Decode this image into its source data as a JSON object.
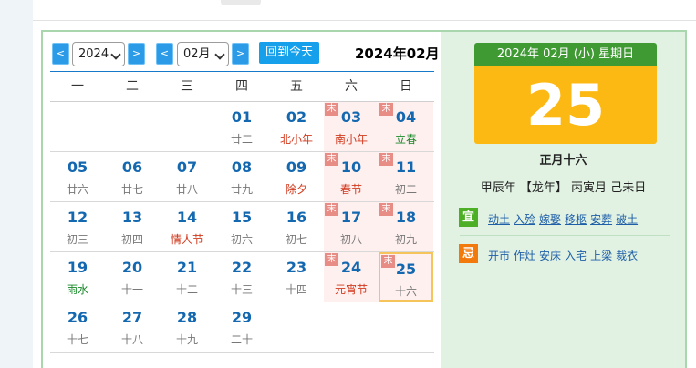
{
  "toolbar": {
    "prev_year": "<",
    "year": "2024",
    "next_year": ">",
    "prev_month": "<",
    "month": "02月",
    "next_month": ">",
    "today_label": "回到今天",
    "title": "2024年02月"
  },
  "weekdays": [
    "一",
    "二",
    "三",
    "四",
    "五",
    "六",
    "日"
  ],
  "badge_text": "末",
  "weeks": [
    [
      {
        "n": "",
        "l": ""
      },
      {
        "n": "",
        "l": ""
      },
      {
        "n": "",
        "l": ""
      },
      {
        "n": "01",
        "l": "廿二"
      },
      {
        "n": "02",
        "l": "北小年",
        "c": "red"
      },
      {
        "n": "03",
        "l": "南小年",
        "c": "red",
        "wk": true,
        "b": true
      },
      {
        "n": "04",
        "l": "立春",
        "c": "green",
        "wk": true,
        "b": true
      }
    ],
    [
      {
        "n": "05",
        "l": "廿六"
      },
      {
        "n": "06",
        "l": "廿七"
      },
      {
        "n": "07",
        "l": "廿八"
      },
      {
        "n": "08",
        "l": "廿九"
      },
      {
        "n": "09",
        "l": "除夕",
        "c": "red"
      },
      {
        "n": "10",
        "l": "春节",
        "c": "red",
        "wk": true,
        "b": true
      },
      {
        "n": "11",
        "l": "初二",
        "wk": true,
        "b": true
      }
    ],
    [
      {
        "n": "12",
        "l": "初三"
      },
      {
        "n": "13",
        "l": "初四"
      },
      {
        "n": "14",
        "l": "情人节",
        "c": "red"
      },
      {
        "n": "15",
        "l": "初六"
      },
      {
        "n": "16",
        "l": "初七"
      },
      {
        "n": "17",
        "l": "初八",
        "wk": true,
        "b": true
      },
      {
        "n": "18",
        "l": "初九",
        "wk": true,
        "b": true
      }
    ],
    [
      {
        "n": "19",
        "l": "雨水",
        "c": "green"
      },
      {
        "n": "20",
        "l": "十一"
      },
      {
        "n": "21",
        "l": "十二"
      },
      {
        "n": "22",
        "l": "十三"
      },
      {
        "n": "23",
        "l": "十四"
      },
      {
        "n": "24",
        "l": "元宵节",
        "c": "red",
        "wk": true,
        "b": true
      },
      {
        "n": "25",
        "l": "十六",
        "wk": true,
        "b": true,
        "selected": true
      }
    ],
    [
      {
        "n": "26",
        "l": "十七"
      },
      {
        "n": "27",
        "l": "十八"
      },
      {
        "n": "28",
        "l": "十九"
      },
      {
        "n": "29",
        "l": "二十"
      },
      {
        "n": "",
        "l": ""
      },
      {
        "n": "",
        "l": ""
      },
      {
        "n": "",
        "l": ""
      }
    ]
  ],
  "detail": {
    "header": "2024年 02月 (小) 星期日",
    "day": "25",
    "lunar": "正月十六",
    "ganzhi": "甲辰年 【龙年】 丙寅月 己未日",
    "yi_label": "宜",
    "yi": [
      "动土",
      "入殓",
      "嫁娶",
      "移柩",
      "安葬",
      "破土"
    ],
    "ji_label": "忌",
    "ji": [
      "开市",
      "作灶",
      "安床",
      "入宅",
      "上梁",
      "裁衣"
    ]
  },
  "colors": {
    "accent": "#16a0ec",
    "weekend_bg": "#fff0f0",
    "badge": "#e88c86",
    "header_green": "#3f9a33",
    "day_yellow": "#fdb913"
  }
}
